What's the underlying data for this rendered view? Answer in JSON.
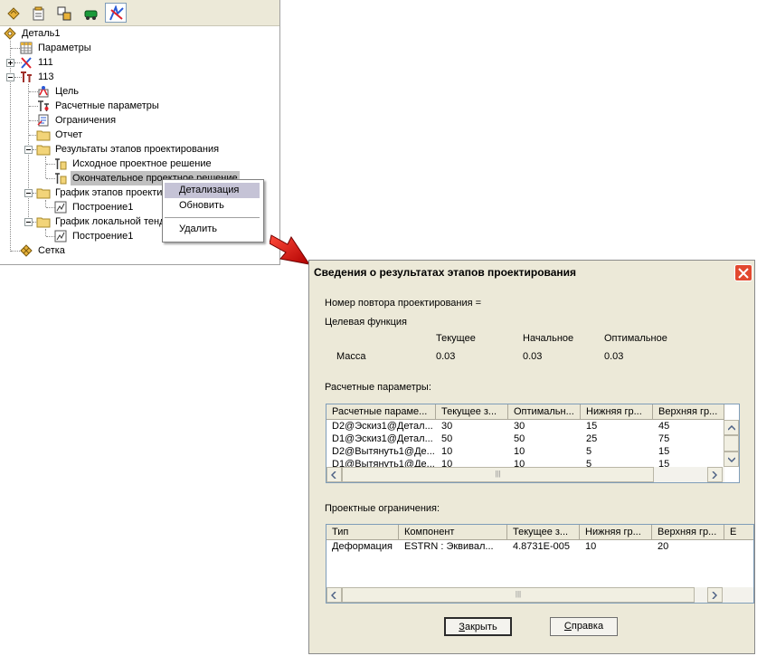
{
  "tree": {
    "nodes": [
      {
        "label": "Деталь1",
        "icon": "part-icon"
      },
      {
        "label": "Параметры",
        "icon": "table-icon"
      },
      {
        "label": "111",
        "icon": "study-icon"
      },
      {
        "label": "113",
        "icon": "optimization-icon"
      },
      {
        "label": "Цель",
        "icon": "target-icon"
      },
      {
        "label": "Расчетные параметры",
        "icon": "design-variables-icon"
      },
      {
        "label": "Ограничения",
        "icon": "constraints-icon"
      },
      {
        "label": "Отчет",
        "icon": "folder-icon"
      },
      {
        "label": "Результаты этапов проектирования",
        "icon": "folder-icon"
      },
      {
        "label": "Исходное проектное решение",
        "icon": "result-icon"
      },
      {
        "label": "Окончательное проектное решение",
        "icon": "result-icon"
      },
      {
        "label": "График этапов проектирования",
        "icon": "folder-icon"
      },
      {
        "label": "Построение1",
        "icon": "plot-icon"
      },
      {
        "label": "График локальной тенденции",
        "icon": "folder-icon"
      },
      {
        "label": "Построение1",
        "icon": "plot-icon"
      },
      {
        "label": "Сетка",
        "icon": "mesh-icon"
      }
    ]
  },
  "context_menu": {
    "items": [
      "Детализация",
      "Обновить",
      "Удалить"
    ]
  },
  "dialog": {
    "title": "Сведения о результатах этапов проектирования",
    "iteration_label": "Номер повтора проектирования =",
    "objective_label": "Целевая функция",
    "objective_headers": [
      "Текущее",
      "Начальное",
      "Оптимальное"
    ],
    "objective_row": {
      "name": "Масса",
      "current": "0.03",
      "initial": "0.03",
      "optimal": "0.03"
    },
    "design_params_label": "Расчетные параметры:",
    "design_params_columns": [
      "Расчетные параме...",
      "Текущее з...",
      "Оптимальн...",
      "Нижняя гр...",
      "Верхняя гр..."
    ],
    "design_params_rows": [
      [
        "D2@Эскиз1@Детал...",
        "30",
        "30",
        "15",
        "45"
      ],
      [
        "D1@Эскиз1@Детал...",
        "50",
        "50",
        "25",
        "75"
      ],
      [
        "D2@Вытянуть1@Де...",
        "10",
        "10",
        "5",
        "15"
      ],
      [
        "D1@Вытянуть1@Де...",
        "10",
        "10",
        "5",
        "15"
      ]
    ],
    "constraints_label": "Проектные ограничения:",
    "constraints_columns": [
      "Тип",
      "Компонент",
      "Текущее з...",
      "Нижняя гр...",
      "Верхняя гр...",
      "Е"
    ],
    "constraints_rows": [
      [
        "Деформация",
        "ESTRN :  Эквивал...",
        "4.8731E-005",
        "10",
        "20",
        ""
      ]
    ],
    "buttons": {
      "close_accel": "З",
      "close_rest": "акрыть",
      "help_accel": "С",
      "help_rest": "правка"
    }
  },
  "colors": {
    "selection": "#c0c0c0",
    "menu_highlight": "#c5c3d6",
    "close_button": "#e2492f",
    "arrow": "#e00000"
  }
}
